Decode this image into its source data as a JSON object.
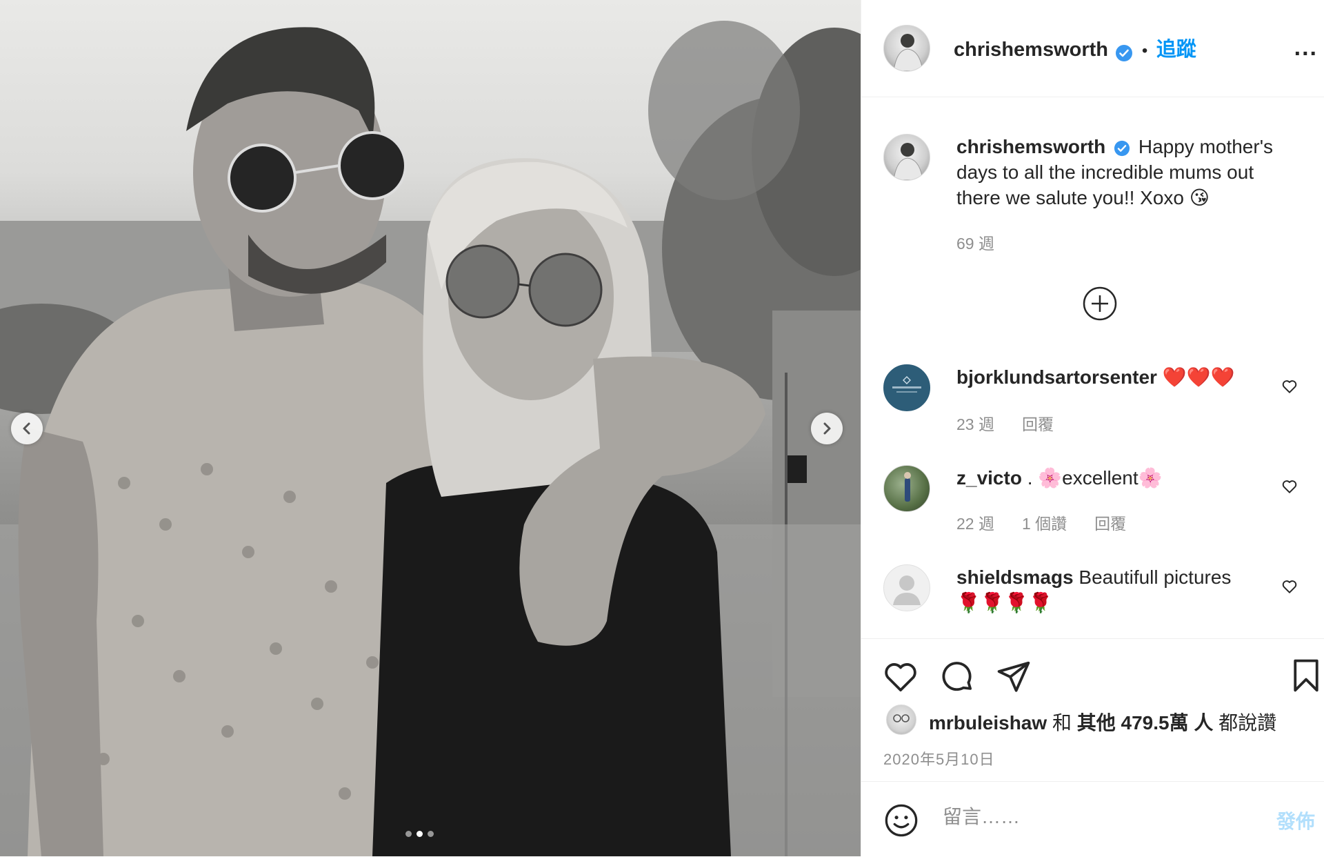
{
  "post": {
    "username": "chrishemsworth",
    "follow_label": "追蹤",
    "separator": "•",
    "more_label": "...",
    "caption": "Happy mother's days to all the incredible mums out there we salute you!! Xoxo 😘",
    "caption_time": "69 週",
    "load_more_icon": "plus-circle-icon"
  },
  "comments": [
    {
      "username": "bjorklundsartorsenter",
      "text": "❤️❤️❤️",
      "time": "23 週",
      "likes": "",
      "reply": "回覆"
    },
    {
      "username": "z_victo",
      "text": ". 🌸excellent🌸",
      "time": "22 週",
      "likes": "1 個讚",
      "reply": "回覆"
    },
    {
      "username": "shieldsmags",
      "text": "Beautifull pictures 🌹🌹🌹🌹",
      "time": "",
      "likes": "",
      "reply": ""
    }
  ],
  "likes": {
    "user": "mrbuleishaw",
    "conj": "和",
    "others": "其他 479.5萬 人",
    "suffix": "都說讚"
  },
  "date": "2020年5月10日",
  "comment_box": {
    "placeholder": "留言……",
    "post_label": "發佈"
  },
  "carousel": {
    "total": 3,
    "active": 2
  },
  "colors": {
    "accent": "#0095f6",
    "muted": "#8e8e8e",
    "verified": "#3897f0"
  }
}
